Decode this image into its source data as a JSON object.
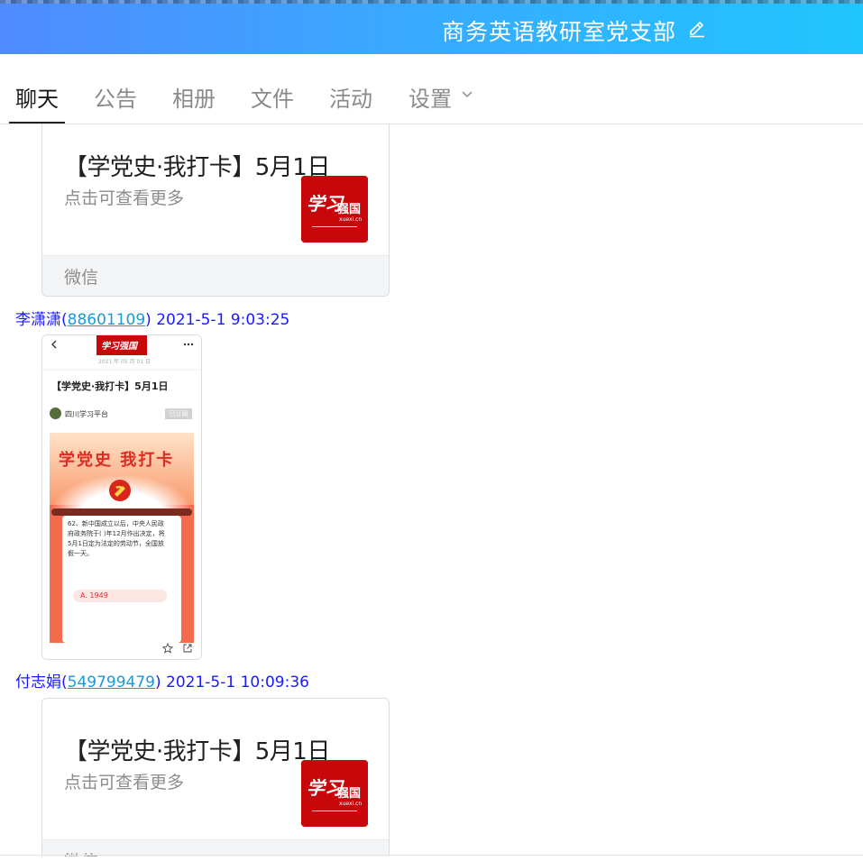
{
  "header": {
    "title": "商务英语教研室党支部",
    "edit_icon": "pencil-icon",
    "gradient": [
      "#4f8bff",
      "#1fc6ff"
    ]
  },
  "tabs": [
    {
      "label": "聊天",
      "active": true
    },
    {
      "label": "公告",
      "active": false
    },
    {
      "label": "相册",
      "active": false
    },
    {
      "label": "文件",
      "active": false
    },
    {
      "label": "活动",
      "active": false
    },
    {
      "label": "设置",
      "active": false,
      "icon": "chevron-down-icon"
    }
  ],
  "messages": [
    {
      "type": "card",
      "title": "【学党史·我打卡】5月1日",
      "subtitle": "点击可查看更多",
      "source": "微信",
      "logo": {
        "text": "学习",
        "text2": "强国",
        "domain": "xuexi.cn",
        "color": "#c8070b"
      }
    },
    {
      "sender": "李潇潇",
      "qq": "88601109",
      "time": "2021-5-1 9:03:25",
      "type": "image",
      "image": {
        "date": "2021 年 05 月 01 日",
        "headline": "【学党史·我打卡】5月1日",
        "publisher": "四川学习平台",
        "badge": "已订阅",
        "banner": "学党史 我打卡",
        "question": "62、新中国成立以后，中央人民政府政务院于( )年12月作出决定，将5月1日定为法定的劳动节，全国放假一天。",
        "option": "A. 1949"
      }
    },
    {
      "sender": "付志娟",
      "qq": "549799479",
      "time": "2021-5-1 10:09:36",
      "type": "card",
      "title": "【学党史·我打卡】5月1日",
      "subtitle": "点击可查看更多",
      "source": "微信"
    }
  ]
}
